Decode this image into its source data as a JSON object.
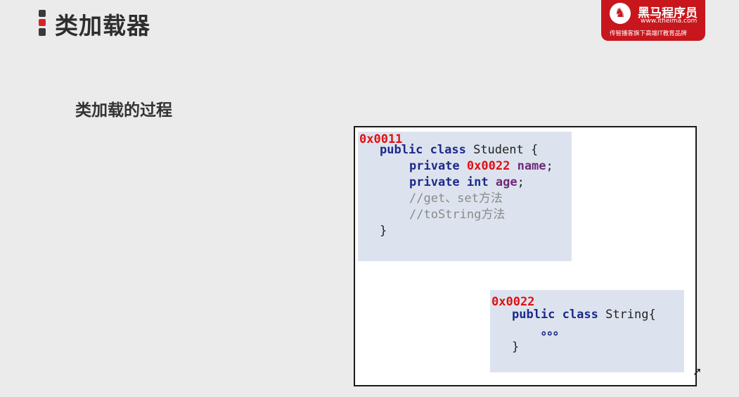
{
  "header": {
    "title": "类加载器"
  },
  "logo": {
    "name": "黑马程序员",
    "url": "www.itheima.com",
    "slogan": "传智播客旗下高端IT教育品牌"
  },
  "section_title": "类加载的过程",
  "diagram": {
    "student_block": {
      "address": "0x0011",
      "class_decl_keywords": "public class",
      "class_name": "Student {",
      "field1_modifier": "private",
      "field1_type_ref": "0x0022",
      "field1_name": "name",
      "field1_end": ";",
      "field2_modifier": "private int",
      "field2_name": "age",
      "field2_end": ";",
      "comment1": "//get、set方法",
      "comment2": "//toString方法",
      "close": "}"
    },
    "string_block": {
      "address": "0x0022",
      "class_decl_keywords": "public class",
      "class_name": "String{",
      "ellipsis": "。。。",
      "close": "}"
    }
  },
  "colors": {
    "address": "#e01010",
    "keyword": "#1c2a8a",
    "field": "#6c2a7a",
    "block_bg": "#dde3ee",
    "logo_bg": "#c8161d"
  }
}
